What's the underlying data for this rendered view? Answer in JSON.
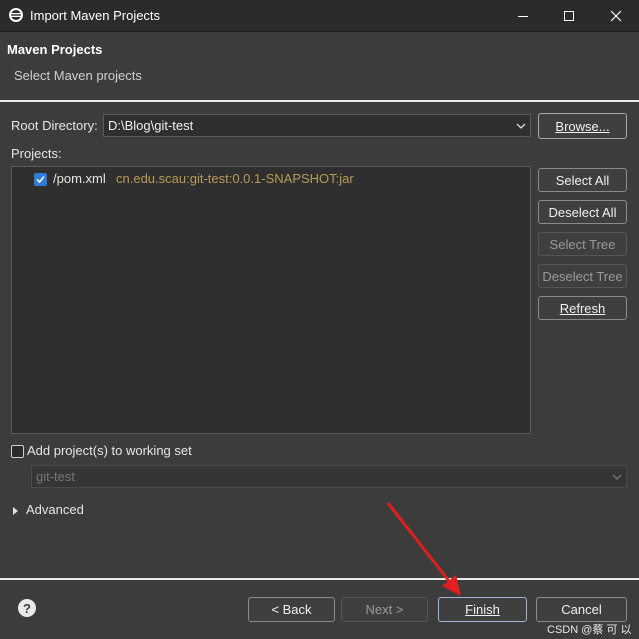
{
  "window": {
    "title": "Import Maven Projects",
    "minimize_icon": "minimize-icon",
    "maximize_icon": "maximize-icon",
    "close_icon": "close-icon"
  },
  "header": {
    "title": "Maven Projects",
    "subtitle": "Select Maven projects"
  },
  "root_directory": {
    "label": "Root Directory:",
    "value": "D:\\Blog\\git-test",
    "browse_label": "Browse..."
  },
  "projects": {
    "label": "Projects:",
    "items": [
      {
        "name": "/pom.xml",
        "artifact": "cn.edu.scau:git-test:0.0.1-SNAPSHOT:jar",
        "checked": true
      }
    ]
  },
  "side_buttons": {
    "select_all": "Select All",
    "deselect_all": "Deselect All",
    "select_tree": "Select Tree",
    "deselect_tree": "Deselect Tree",
    "refresh": "Refresh"
  },
  "working_set": {
    "label": "Add project(s) to working set",
    "value": "git-test",
    "checked": false
  },
  "advanced": {
    "label": "Advanced"
  },
  "footer": {
    "back": "< Back",
    "next": "Next >",
    "finish": "Finish",
    "cancel": "Cancel"
  },
  "watermark": "CSDN @蔡 可 以",
  "colors": {
    "background": "#3c3c3c",
    "checkbox_checked": "#2f7bd6",
    "artifact_text": "#b89a55",
    "annotation_arrow": "#e02020"
  }
}
